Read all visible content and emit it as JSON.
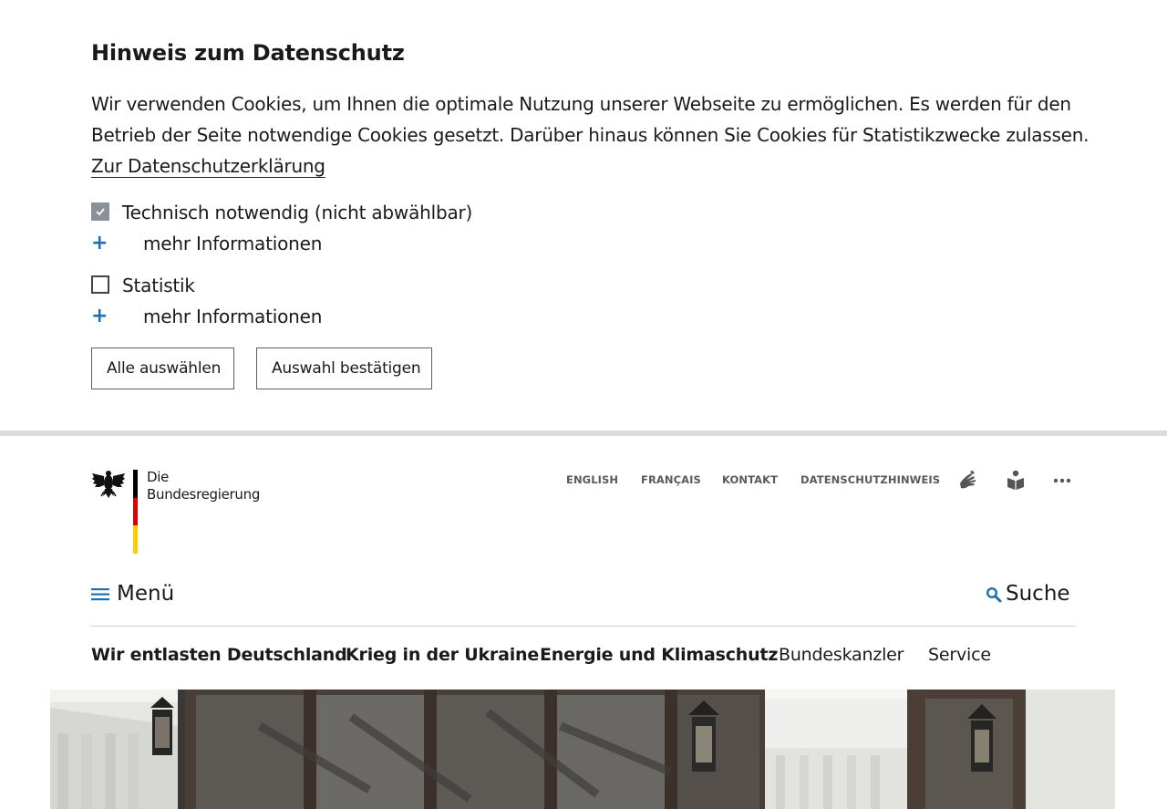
{
  "cookie_banner": {
    "title": "Hinweis zum Datenschutz",
    "intro_text": "Wir verwenden Cookies, um Ihnen die optimale Nutzung unserer Webseite zu ermöglichen. Es werden für den Betrieb der Seite notwendige Cookies gesetzt. Darüber hinaus können Sie Cookies für Statistikzwecke zulassen.",
    "privacy_link": "Zur Datenschutzerklärung",
    "options": [
      {
        "label": "Technisch notwendig (nicht abwählbar)",
        "checked": true,
        "disabled": true,
        "more_info": "mehr Informationen"
      },
      {
        "label": "Statistik",
        "checked": false,
        "disabled": false,
        "more_info": "mehr Informationen"
      }
    ],
    "buttons": {
      "select_all": "Alle auswählen",
      "confirm": "Auswahl bestätigen"
    }
  },
  "header": {
    "logo": {
      "line1": "Die",
      "line2": "Bundesregierung"
    },
    "meta_links": [
      "ENGLISH",
      "FRANÇAIS",
      "KONTAKT",
      "DATENSCHUTZHINWEIS"
    ],
    "meta_icons": [
      "sign-language-icon",
      "easy-language-icon",
      "more-icon"
    ],
    "menu_label": "Menü",
    "search_label": "Suche",
    "nav": [
      {
        "label": "Wir entlasten Deutschland",
        "bold": true
      },
      {
        "label": "Krieg in der Ukraine",
        "bold": true
      },
      {
        "label": "Energie und Klimaschutz",
        "bold": true
      },
      {
        "label": "Bundeskanzler",
        "bold": false
      },
      {
        "label": "Service",
        "bold": false
      }
    ]
  },
  "colors": {
    "accent_blue": "#1f6fb2",
    "flag_black": "#000000",
    "flag_red": "#dd0000",
    "flag_gold": "#ffcc00",
    "separator": "#dcdcdc"
  }
}
